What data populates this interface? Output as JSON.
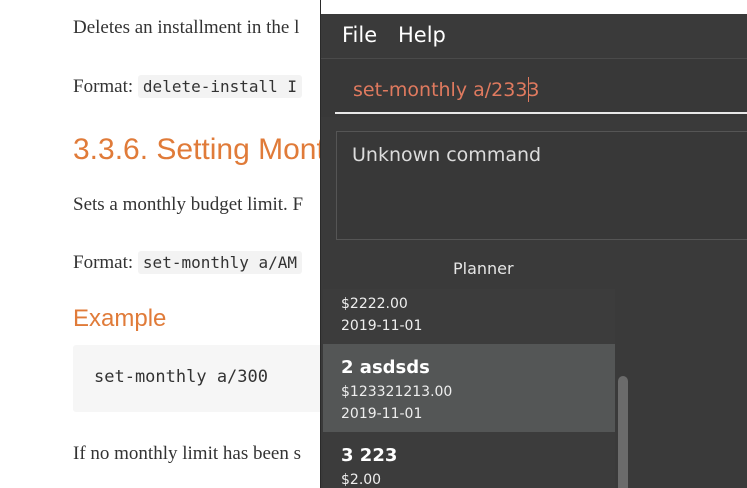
{
  "doc": {
    "delete_text": "Deletes an installment in the l",
    "format_label_1": "Format:",
    "format_code_1": "delete-install I",
    "section_heading": "3.3.6. Setting Mont",
    "sets_text": "Sets a monthly budget limit. F",
    "format_label_2": "Format:",
    "format_code_2": "set-monthly a/AM",
    "example_heading": "Example",
    "example_code": "set-monthly a/300",
    "no_limit_text": "If no monthly limit has been s"
  },
  "app": {
    "menu": {
      "file": "File",
      "help": "Help"
    },
    "command_input": {
      "value": "set-monthly a/2333"
    },
    "result": {
      "text": "Unknown command"
    },
    "planner_label": "Planner",
    "items": [
      {
        "title": "",
        "amount": "$2222.00",
        "date": "2019-11-01"
      },
      {
        "title": "2  asdsds",
        "amount": "$123321213.00",
        "date": "2019-11-01"
      },
      {
        "title": "3  223",
        "amount": "$2.00",
        "date": ""
      }
    ],
    "colors": {
      "accent_orange": "#e07b39",
      "input_text": "#e07a5f",
      "app_background": "#3a3a3a",
      "selected_item": "#545656"
    }
  }
}
